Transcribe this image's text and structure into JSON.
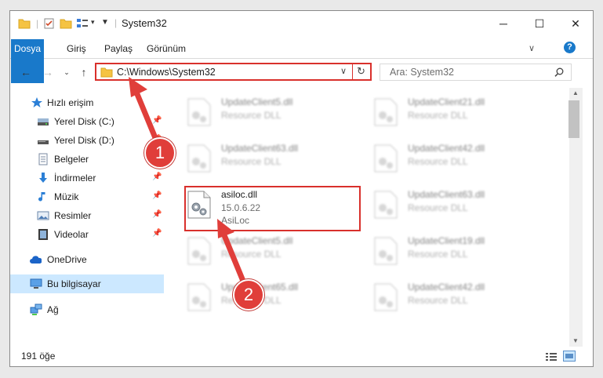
{
  "window": {
    "title": "System32",
    "buttons": {
      "minimize": "─",
      "maximize": "☐",
      "close": "✕"
    }
  },
  "ribbon": {
    "tabs": [
      "Dosya",
      "Giriş",
      "Paylaş",
      "Görünüm"
    ],
    "help": "?"
  },
  "address": {
    "path": "C:\\Windows\\System32",
    "search_placeholder": "Ara: System32"
  },
  "sidebar": {
    "items": [
      {
        "label": "Hızlı erişim",
        "icon": "star-icon",
        "pinned": false
      },
      {
        "label": "Yerel Disk (C:)",
        "icon": "drive-icon",
        "pinned": true
      },
      {
        "label": "Yerel Disk (D:)",
        "icon": "drive-icon",
        "pinned": true
      },
      {
        "label": "Belgeler",
        "icon": "documents-icon",
        "pinned": true
      },
      {
        "label": "İndirmeler",
        "icon": "download-icon",
        "pinned": true
      },
      {
        "label": "Müzik",
        "icon": "music-icon",
        "pinned": true
      },
      {
        "label": "Resimler",
        "icon": "pictures-icon",
        "pinned": true
      },
      {
        "label": "Videolar",
        "icon": "video-icon",
        "pinned": true
      },
      {
        "label": "OneDrive",
        "icon": "cloud-icon",
        "pinned": false
      },
      {
        "label": "Bu bilgisayar",
        "icon": "computer-icon",
        "pinned": false,
        "selected": true
      },
      {
        "label": "Ağ",
        "icon": "network-icon",
        "pinned": false
      }
    ]
  },
  "files": [
    {
      "name": "UpdateClient5.dll",
      "sub1": "Resource DLL",
      "blurred": true
    },
    {
      "name": "UpdateClient21.dll",
      "sub1": "Resource DLL",
      "blurred": true
    },
    {
      "name": "UpdateClient63.dll",
      "sub1": "Resource DLL",
      "blurred": true
    },
    {
      "name": "UpdateClient42.dll",
      "sub1": "Resource DLL",
      "blurred": true
    },
    {
      "name": "asiloc.dll",
      "sub1": "15.0.6.22",
      "sub2": "AsiLoc",
      "blurred": false
    },
    {
      "name": "UpdateClient63.dll",
      "sub1": "Resource DLL",
      "blurred": true
    },
    {
      "name": "UpdateClient5.dll",
      "sub1": "Resource DLL",
      "blurred": true
    },
    {
      "name": "UpdateClient19.dll",
      "sub1": "Resource DLL",
      "blurred": true
    },
    {
      "name": "UpdateClient65.dll",
      "sub1": "Resource DLL",
      "blurred": true
    },
    {
      "name": "UpdateClient42.dll",
      "sub1": "Resource DLL",
      "blurred": true
    }
  ],
  "status": {
    "count": "191 öğe"
  },
  "callouts": [
    "1",
    "2"
  ],
  "colors": {
    "accent": "#1979ca",
    "highlight": "#d9302c",
    "selected": "#cce8ff"
  }
}
